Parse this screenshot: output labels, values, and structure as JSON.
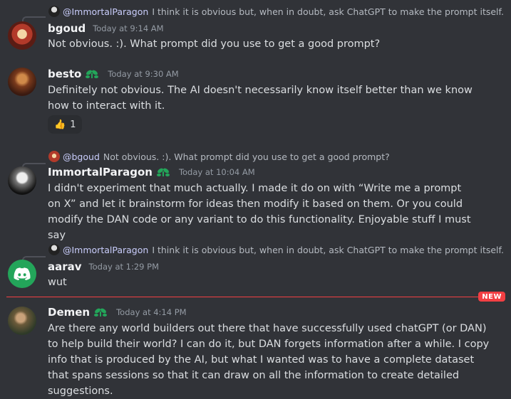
{
  "reply_bgoud": {
    "mention": "@ImmortalParagon",
    "preview": "I think it is obvious but, when in doubt, ask ChatGPT to make the prompt itself."
  },
  "msg_bgoud": {
    "username": "bgoud",
    "timestamp": "Today at 9:14 AM",
    "text": "Not obvious.  :). What prompt did you use to get a good prompt?"
  },
  "msg_besto": {
    "username": "besto",
    "timestamp": "Today at 9:30 AM",
    "text": "Definitely not obvious. The AI doesn't necessarily know itself better than we know how to interact with it.",
    "reaction": {
      "emoji": "👍",
      "count": "1"
    }
  },
  "reply_immortal": {
    "mention": "@bgoud",
    "preview": "Not obvious.  :). What prompt did you use to get a good prompt?"
  },
  "msg_immortal": {
    "username": "ImmortalParagon",
    "timestamp": "Today at 10:04 AM",
    "text": "I didn't experiment that much actually. I made it do on with “Write me a prompt on X” and let it brainstorm for ideas then modify it based on them. Or you could modify the DAN code or any variant to do this functionality. Enjoyable stuff I must say"
  },
  "reply_aarav": {
    "mention": "@ImmortalParagon",
    "preview": "I think it is obvious but, when in doubt, ask ChatGPT to make the prompt itself."
  },
  "msg_aarav": {
    "username": "aarav",
    "timestamp": "Today at 1:29 PM",
    "text": "wut"
  },
  "new_divider": {
    "label": "NEW",
    "color": "#f23f43"
  },
  "msg_demen": {
    "username": "Demen",
    "timestamp": "Today at 4:14 PM",
    "text": "Are there any world builders out there that have successfully used chatGPT (or DAN) to help build their world? I can do it, but DAN forgets information after a while. I copy info that is produced by the AI, but what I wanted was to have a complete dataset that spans sessions so that it can draw on all the information to create detailed suggestions."
  },
  "colors": {
    "background": "#313338",
    "username": "#f2f3f5",
    "body_text": "#dbdee1",
    "timestamp": "#949ba4",
    "mention": "#c9cdfb",
    "badge_green": "#23a55a",
    "discord_green": "#23a55a"
  },
  "icons": {
    "badge": "green-leaf-badge-icon",
    "default_avatar": "discord-logo-icon"
  }
}
